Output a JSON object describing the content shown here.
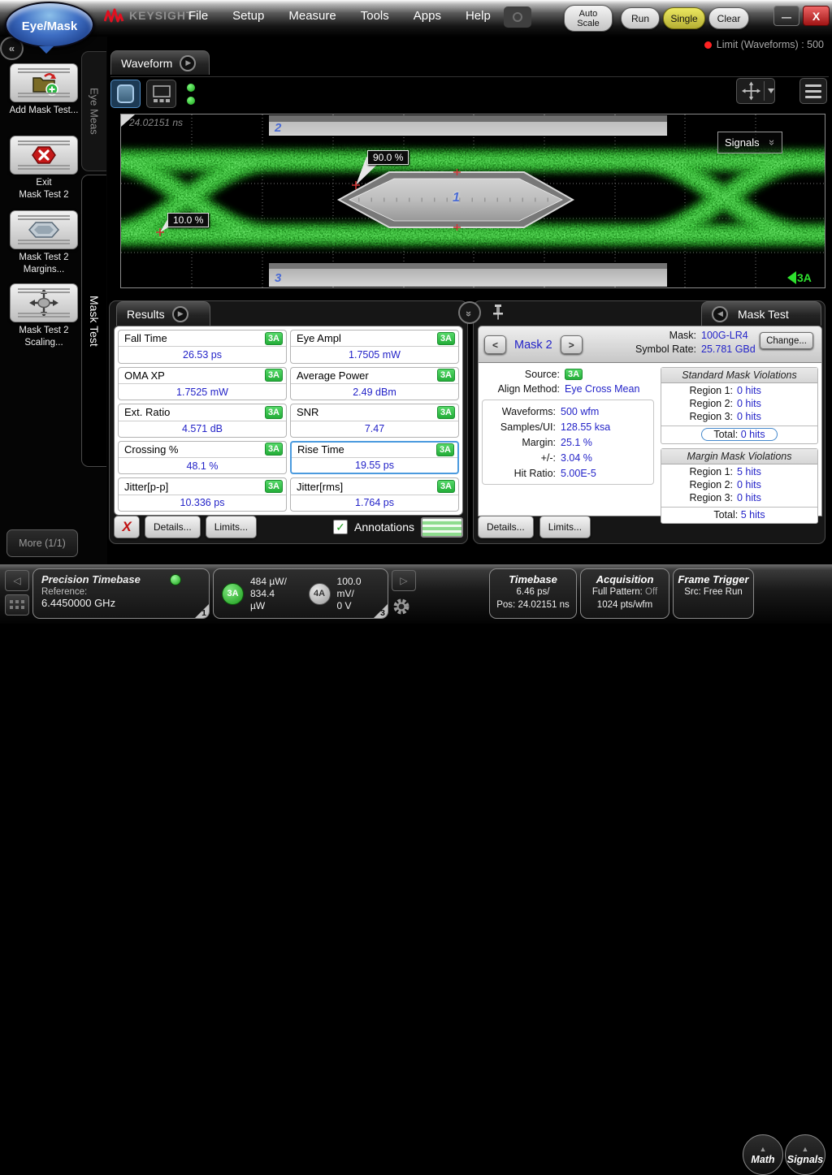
{
  "topbar": {
    "logo": "Eye/Mask",
    "brand": "KEYSIGHT",
    "menus": [
      "File",
      "Setup",
      "Measure",
      "Tools",
      "Apps",
      "Help"
    ],
    "auto_scale_line1": "Auto",
    "auto_scale_line2": "Scale",
    "run": "Run",
    "single": "Single",
    "clear": "Clear",
    "limit": "Limit (Waveforms) : 500"
  },
  "icons": {
    "play": "▶",
    "back": "◀",
    "collapse": "«",
    "chevron_double": "»",
    "check": "✓",
    "up_triangle": "▲",
    "minimize": "—",
    "close": "X",
    "delete_x": "X",
    "left_arrow": "◁",
    "right_arrow": "▷",
    "prev": "<",
    "next": ">"
  },
  "sidebar": {
    "tab_eye_meas": "Eye Meas",
    "tab_mask_test": "Mask Test",
    "add_mask": "Add Mask Test...",
    "exit_line1": "Exit",
    "exit_line2": "Mask Test 2",
    "margins_line1": "Mask Test 2",
    "margins_line2": "Margins...",
    "scaling_line1": "Mask Test 2",
    "scaling_line2": "Scaling...",
    "more": "More (1/1)"
  },
  "waveform": {
    "tab": "Waveform",
    "timebase_ref": "24.02151 ns",
    "region2": "2",
    "region1": "1",
    "region3": "3",
    "label_90": "90.0 %",
    "label_10": "10.0 %",
    "signals_dropdown": "Signals",
    "marker": "3A"
  },
  "results": {
    "tab": "Results",
    "items": [
      {
        "name": "Fall Time",
        "value": "26.53 ps",
        "source": "3A"
      },
      {
        "name": "Eye Ampl",
        "value": "1.7505 mW",
        "source": "3A"
      },
      {
        "name": "OMA XP",
        "value": "1.7525 mW",
        "source": "3A"
      },
      {
        "name": "Average Power",
        "value": "2.49 dBm",
        "source": "3A"
      },
      {
        "name": "Ext. Ratio",
        "value": "4.571 dB",
        "source": "3A"
      },
      {
        "name": "SNR",
        "value": "7.47",
        "source": "3A"
      },
      {
        "name": "Crossing %",
        "value": "48.1 %",
        "source": "3A"
      },
      {
        "name": "Rise Time",
        "value": "19.55 ps",
        "source": "3A"
      },
      {
        "name": "Jitter[p-p]",
        "value": "10.336 ps",
        "source": "3A"
      },
      {
        "name": "Jitter[rms]",
        "value": "1.764 ps",
        "source": "3A"
      }
    ],
    "details": "Details...",
    "limits": "Limits...",
    "annotations": "Annotations"
  },
  "mask_test": {
    "tab": "Mask Test",
    "nav_label": "Mask 2",
    "mask_label": "Mask:",
    "mask_value": "100G-LR4",
    "change": "Change...",
    "symbol_rate_label": "Symbol Rate:",
    "symbol_rate_value": "25.781 GBd",
    "source_label": "Source:",
    "source_value": "3A",
    "align_label": "Align Method:",
    "align_value": "Eye Cross Mean",
    "stats": [
      {
        "label": "Waveforms:",
        "value": "500 wfm"
      },
      {
        "label": "Samples/UI:",
        "value": "128.55 ksa"
      },
      {
        "label": "Margin:",
        "value": "25.1 %"
      },
      {
        "label": "+/-:",
        "value": "3.04 %"
      },
      {
        "label": "Hit Ratio:",
        "value": "5.00E-5"
      }
    ],
    "standard": {
      "title": "Standard Mask Violations",
      "regions": [
        {
          "label": "Region 1:",
          "value": "0 hits"
        },
        {
          "label": "Region 2:",
          "value": "0 hits"
        },
        {
          "label": "Region 3:",
          "value": "0 hits"
        }
      ],
      "total_label": "Total:",
      "total_value": "0 hits"
    },
    "margin": {
      "title": "Margin Mask Violations",
      "regions": [
        {
          "label": "Region 1:",
          "value": "5 hits"
        },
        {
          "label": "Region 2:",
          "value": "0 hits"
        },
        {
          "label": "Region 3:",
          "value": "0 hits"
        }
      ],
      "total_label": "Total:",
      "total_value": "5 hits"
    },
    "details": "Details...",
    "limits": "Limits..."
  },
  "statusbar": {
    "precision": {
      "title": "Precision Timebase",
      "ref_label": "Reference:",
      "ref_value": "6.4450000 GHz",
      "badge": "1"
    },
    "channels": {
      "ch3_id": "3A",
      "ch3_line1": "484 µW/",
      "ch3_line2": "834.4 µW",
      "ch4_id": "4A",
      "ch4_line1": "100.0 mV/",
      "ch4_line2": "0 V",
      "badge": "3"
    },
    "timebase": {
      "title": "Timebase",
      "scale": "6.46 ps/",
      "position": "Pos: 24.02151 ns"
    },
    "acquisition": {
      "title": "Acquisition",
      "pattern_label": "Full Pattern:",
      "pattern_value": "Off",
      "points": "1024 pts/wfm"
    },
    "frame_trigger": {
      "title": "Frame Trigger",
      "source": "Src: Free Run"
    },
    "math": "Math",
    "signals": "Signals"
  },
  "colors": {
    "value_blue": "#2323c8",
    "badge_green": "#35c946",
    "trace_green": "#2eb82e",
    "single_yellow": "#d6d05a",
    "close_red": "#c03030"
  }
}
